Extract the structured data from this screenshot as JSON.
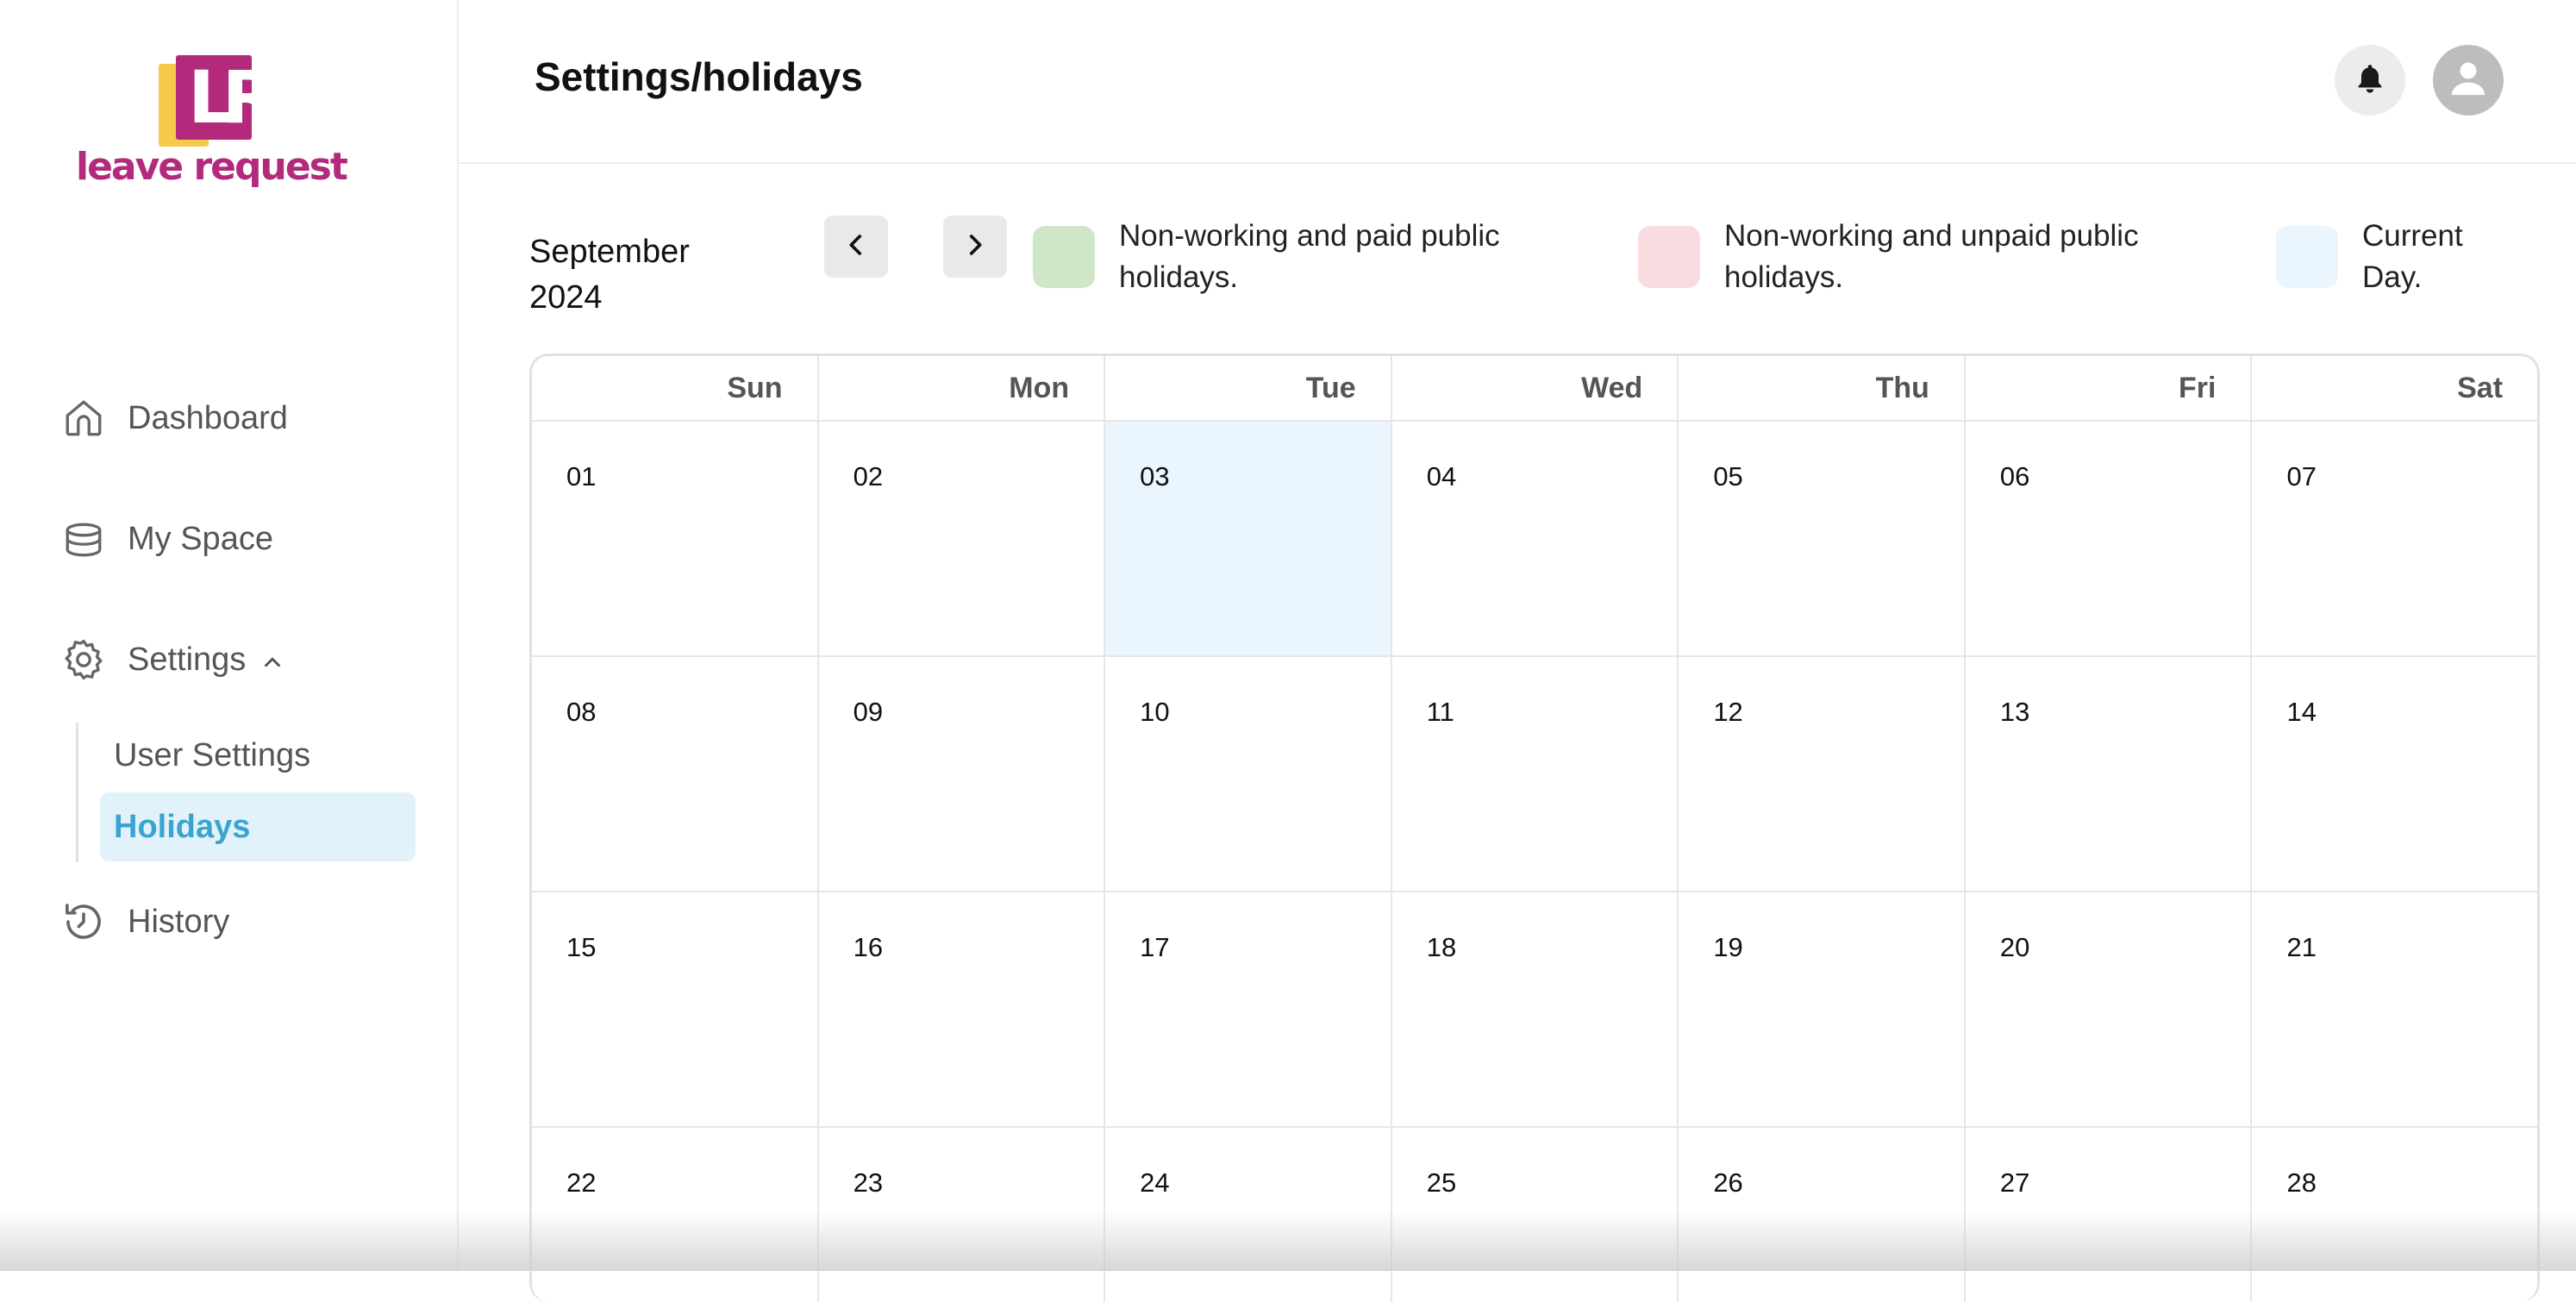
{
  "app": {
    "logo_text": "leave request",
    "logo_letters": "LR"
  },
  "sidebar": {
    "items": [
      {
        "label": "Dashboard",
        "icon": "home-icon"
      },
      {
        "label": "My Space",
        "icon": "briefcase-icon"
      },
      {
        "label": "Settings",
        "icon": "gear-icon",
        "expanded": true
      },
      {
        "label": "History",
        "icon": "history-icon"
      }
    ],
    "settings_sub": [
      {
        "label": "User Settings",
        "active": false
      },
      {
        "label": "Holidays",
        "active": true
      }
    ]
  },
  "header": {
    "title": "Settings/holidays",
    "icons": [
      "bell-icon",
      "user-avatar-icon"
    ]
  },
  "calendar": {
    "month": "September",
    "year": "2024",
    "prev_icon": "chevron-left-icon",
    "next_icon": "chevron-right-icon",
    "legend": [
      {
        "label": "Non-working and paid public holidays.",
        "color": "#cfe6c8"
      },
      {
        "label": "Non-working and unpaid public holidays.",
        "color": "#f8dcdf"
      },
      {
        "label": "Current Day.",
        "color": "#ebf5fe"
      }
    ],
    "weekdays": [
      "Sun",
      "Mon",
      "Tue",
      "Wed",
      "Thu",
      "Fri",
      "Sat"
    ],
    "weeks": [
      [
        "01",
        "02",
        "03",
        "04",
        "05",
        "06",
        "07"
      ],
      [
        "08",
        "09",
        "10",
        "11",
        "12",
        "13",
        "14"
      ],
      [
        "15",
        "16",
        "17",
        "18",
        "19",
        "20",
        "21"
      ],
      [
        "22",
        "23",
        "24",
        "25",
        "26",
        "27",
        "28"
      ]
    ],
    "current_day": "03"
  },
  "colors": {
    "brand": "#b32a7c",
    "brand_yellow": "#f6c94a",
    "active_text": "#3aa4d1",
    "active_bg": "#e2f2fb"
  }
}
